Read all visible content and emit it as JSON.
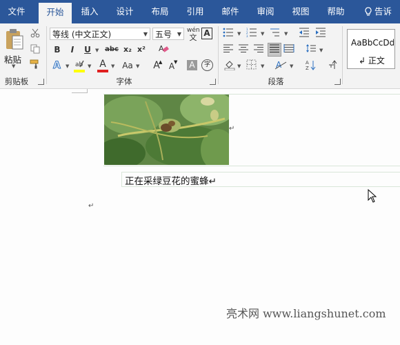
{
  "tabs": [
    {
      "label": "文件",
      "active": false
    },
    {
      "label": "开始",
      "active": true
    },
    {
      "label": "插入",
      "active": false
    },
    {
      "label": "设计",
      "active": false
    },
    {
      "label": "布局",
      "active": false
    },
    {
      "label": "引用",
      "active": false
    },
    {
      "label": "邮件",
      "active": false
    },
    {
      "label": "审阅",
      "active": false
    },
    {
      "label": "视图",
      "active": false
    },
    {
      "label": "帮助",
      "active": false
    }
  ],
  "tell_me": "告诉我",
  "ribbon": {
    "clipboard": {
      "label": "剪贴板",
      "paste_label": "粘贴"
    },
    "font": {
      "label": "字体",
      "font_name": "等线 (中文正文)",
      "font_size": "五号",
      "phonetic_guide": "wén",
      "bold": "B",
      "italic": "I",
      "underline": "U",
      "strikethrough": "abc",
      "subscript": "x₂",
      "superscript": "x²",
      "case": "Aa",
      "grow_font": "A",
      "shrink_font": "A",
      "char_shading": "A",
      "enclose": "字",
      "highlight_color": "#ffff00",
      "font_color": "#e02020"
    },
    "paragraph": {
      "label": "段落"
    },
    "styles": {
      "sample": "AaBbCcDd",
      "name": "↲ 正文"
    }
  },
  "document": {
    "caption": "正在采绿豆花的蜜蜂↵",
    "para_mark": "↵"
  },
  "watermark": "亮术网 www.liangshunet.com"
}
